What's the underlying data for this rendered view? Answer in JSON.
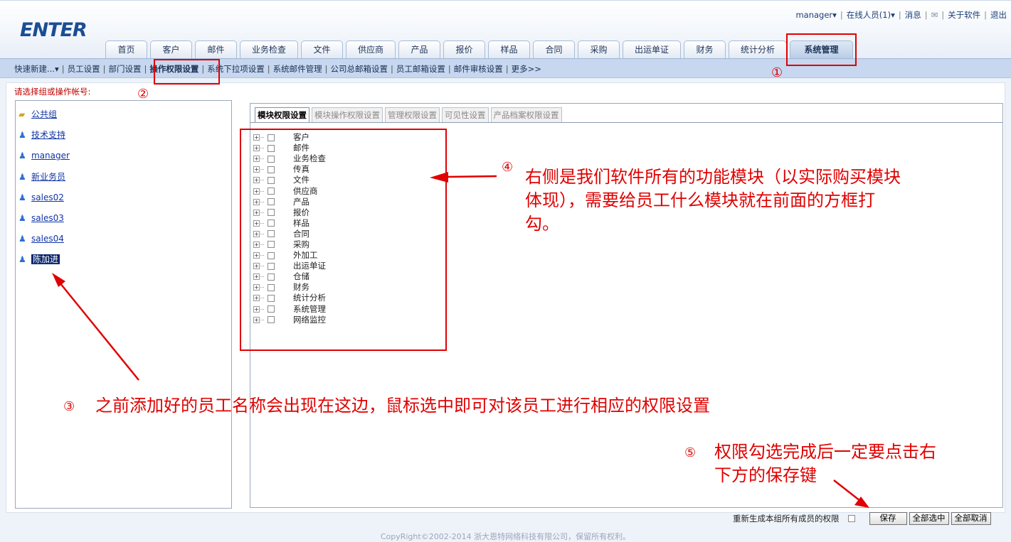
{
  "logo": "ENTER",
  "top_links": {
    "user": "manager▾",
    "online": "在线人员(1)▾",
    "messages": "消息",
    "about": "关于软件",
    "logout": "退出"
  },
  "tabs": [
    "首页",
    "客户",
    "邮件",
    "业务检查",
    "文件",
    "供应商",
    "产品",
    "报价",
    "样品",
    "合同",
    "采购",
    "出运单证",
    "财务",
    "统计分析",
    "系统管理"
  ],
  "active_tab": "系统管理",
  "subnav": [
    "快速新建...▾",
    "员工设置",
    "部门设置",
    "操作权限设置",
    "系统下拉项设置",
    "系统邮件管理",
    "公司总邮箱设置",
    "员工邮箱设置",
    "邮件审核设置",
    "更多>>"
  ],
  "prompt_label": "请选择组或操作帐号:",
  "users": [
    {
      "label": "公共组",
      "icon": "group-folder-icon"
    },
    {
      "label": "技术支持",
      "icon": "user-icon"
    },
    {
      "label": "manager",
      "icon": "user-icon"
    },
    {
      "label": "新业务员",
      "icon": "user-icon"
    },
    {
      "label": "sales02",
      "icon": "user-icon"
    },
    {
      "label": "sales03",
      "icon": "user-icon"
    },
    {
      "label": "sales04",
      "icon": "user-icon"
    },
    {
      "label": "陈加进",
      "icon": "user-icon",
      "selected": true
    }
  ],
  "perm_tabs": [
    "模块权限设置",
    "模块操作权限设置",
    "管理权限设置",
    "可见性设置",
    "产品档案权限设置"
  ],
  "modules": [
    "客户",
    "邮件",
    "业务检查",
    "传真",
    "文件",
    "供应商",
    "产品",
    "报价",
    "样品",
    "合同",
    "采购",
    "外加工",
    "出运单证",
    "仓储",
    "财务",
    "统计分析",
    "系统管理",
    "网络监控"
  ],
  "annotations": {
    "n1": "①",
    "n2": "②",
    "n3": "③",
    "n4": "④",
    "n5": "⑤",
    "text3": "之前添加好的员工名称会出现在这边，鼠标选中即可对该员工进行相应的权限设置",
    "text4_line1": "右侧是我们软件所有的功能模块（以实际购买模块",
    "text4_line2": "体现），需要给员工什么模块就在前面的方框打",
    "text4_line3": "勾。",
    "text5_line1": "权限勾选完成后一定要点击右",
    "text5_line2": "下方的保存键"
  },
  "footer": {
    "regen_label": "重新生成本组所有成员的权限",
    "save": "保存",
    "select_all": "全部选中",
    "deselect_all": "全部取消"
  },
  "copyright": "CopyRight©2002-2014 浙大恩特网络科技有限公司，保留所有权利。",
  "colors": {
    "accent_red": "#e00000",
    "nav_blue": "#c6d7ef",
    "link_blue": "#1034a6"
  }
}
